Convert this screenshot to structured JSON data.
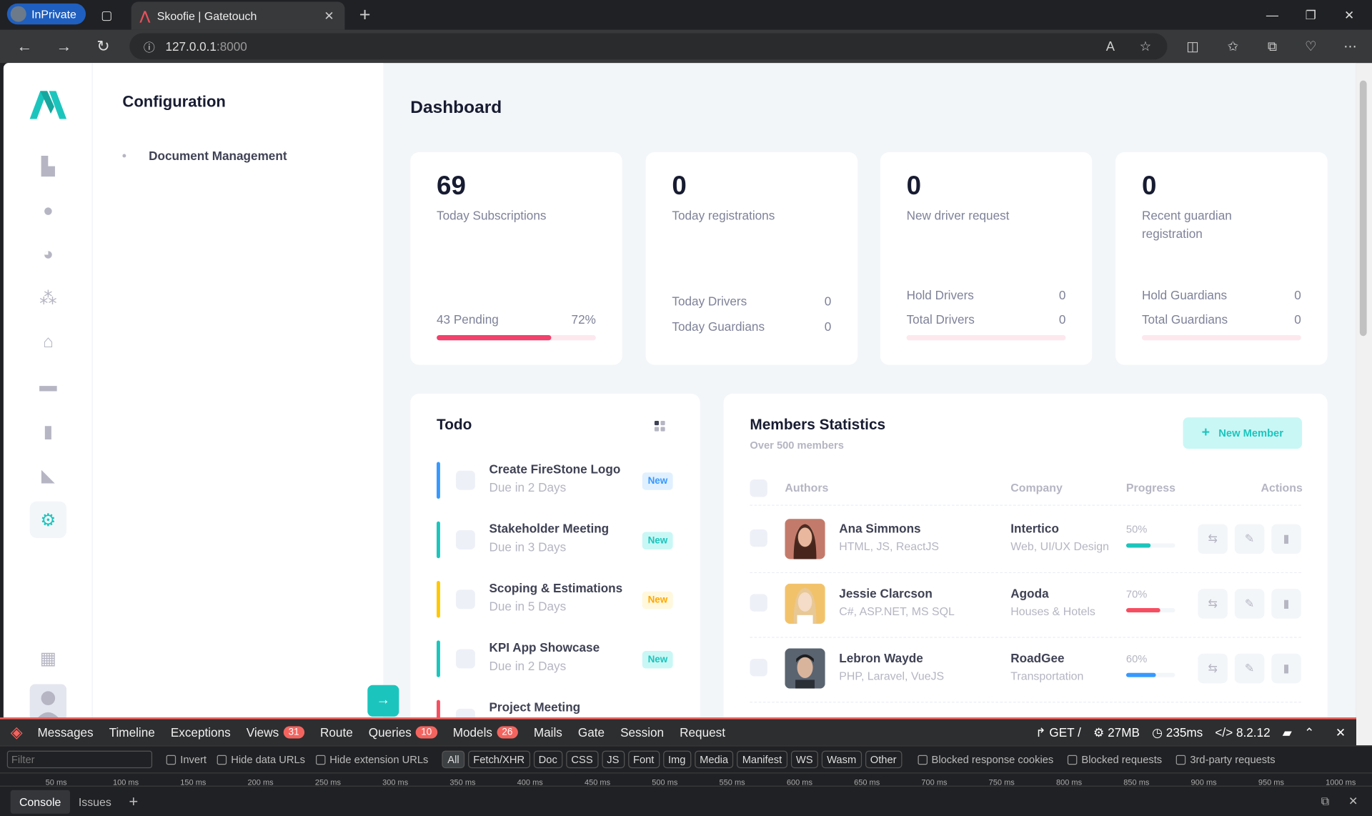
{
  "browser": {
    "inprivate_label": "InPrivate",
    "tab_title": "Skoofie | Gatetouch",
    "url_host": "127.0.0.1",
    "url_port": ":8000"
  },
  "secondary_menu": {
    "title": "Configuration",
    "items": [
      {
        "label": "Document Management"
      }
    ]
  },
  "main": {
    "title": "Dashboard"
  },
  "stats": [
    {
      "value": "69",
      "label": "Today Subscriptions",
      "pending": "43 Pending",
      "percent": "72%",
      "progress": 0.72
    },
    {
      "value": "0",
      "label": "Today registrations",
      "rows": [
        {
          "k": "Today Drivers",
          "v": "0"
        },
        {
          "k": "Today Guardians",
          "v": "0"
        }
      ]
    },
    {
      "value": "0",
      "label": "New driver request",
      "rows": [
        {
          "k": "Hold Drivers",
          "v": "0"
        },
        {
          "k": "Total Drivers",
          "v": "0"
        }
      ]
    },
    {
      "value": "0",
      "label": "Recent guardian registration",
      "rows": [
        {
          "k": "Hold Guardians",
          "v": "0"
        },
        {
          "k": "Total Guardians",
          "v": "0"
        }
      ]
    }
  ],
  "todo": {
    "title": "Todo",
    "items": [
      {
        "title": "Create FireStone Logo",
        "due": "Due in 2 Days",
        "badge": "New",
        "color": "#3699ff"
      },
      {
        "title": "Stakeholder Meeting",
        "due": "Due in 3 Days",
        "badge": "New",
        "color": "#1bc5bd"
      },
      {
        "title": "Scoping & Estimations",
        "due": "Due in 5 Days",
        "badge": "New",
        "color": "#ffa800"
      },
      {
        "title": "KPI App Showcase",
        "due": "Due in 2 Days",
        "badge": "New",
        "color": "#1bc5bd"
      },
      {
        "title": "Project Meeting",
        "due": "",
        "badge": "",
        "color": "#f64e60"
      }
    ]
  },
  "members": {
    "title": "Members Statistics",
    "subtitle": "Over 500 members",
    "new_button": "New Member",
    "columns": [
      "Authors",
      "Company",
      "Progress",
      "Actions"
    ],
    "rows": [
      {
        "name": "Ana Simmons",
        "skills": "HTML, JS, ReactJS",
        "company": "Intertico",
        "company_sub": "Web, UI/UX Design",
        "progress_label": "50%",
        "progress": 0.5,
        "color": "#1bc5bd"
      },
      {
        "name": "Jessie Clarcson",
        "skills": "C#, ASP.NET, MS SQL",
        "company": "Agoda",
        "company_sub": "Houses & Hotels",
        "progress_label": "70%",
        "progress": 0.7,
        "color": "#f64e60"
      },
      {
        "name": "Lebron Wayde",
        "skills": "PHP, Laravel, VueJS",
        "company": "RoadGee",
        "company_sub": "Transportation",
        "progress_label": "60%",
        "progress": 0.6,
        "color": "#3699ff"
      }
    ]
  },
  "debugbar": {
    "tabs": [
      {
        "label": "Messages"
      },
      {
        "label": "Timeline"
      },
      {
        "label": "Exceptions"
      },
      {
        "label": "Views",
        "count": "31"
      },
      {
        "label": "Route"
      },
      {
        "label": "Queries",
        "count": "10"
      },
      {
        "label": "Models",
        "count": "26"
      },
      {
        "label": "Mails"
      },
      {
        "label": "Gate"
      },
      {
        "label": "Session"
      },
      {
        "label": "Request"
      }
    ],
    "method": "GET /",
    "memory": "27MB",
    "time": "235ms",
    "php": "8.2.12"
  },
  "devtools": {
    "filter_placeholder": "Filter",
    "checks": [
      "Invert",
      "Hide data URLs",
      "Hide extension URLs"
    ],
    "types": [
      "All",
      "Fetch/XHR",
      "Doc",
      "CSS",
      "JS",
      "Font",
      "Img",
      "Media",
      "Manifest",
      "WS",
      "Wasm",
      "Other"
    ],
    "checks2": [
      "Blocked response cookies",
      "Blocked requests",
      "3rd-party requests"
    ],
    "ticks": [
      "50 ms",
      "100 ms",
      "150 ms",
      "200 ms",
      "250 ms",
      "300 ms",
      "350 ms",
      "400 ms",
      "450 ms",
      "500 ms",
      "550 ms",
      "600 ms",
      "650 ms",
      "700 ms",
      "750 ms",
      "800 ms",
      "850 ms",
      "900 ms",
      "950 ms",
      "1000 ms"
    ],
    "bottom_tabs": [
      "Console",
      "Issues"
    ]
  }
}
